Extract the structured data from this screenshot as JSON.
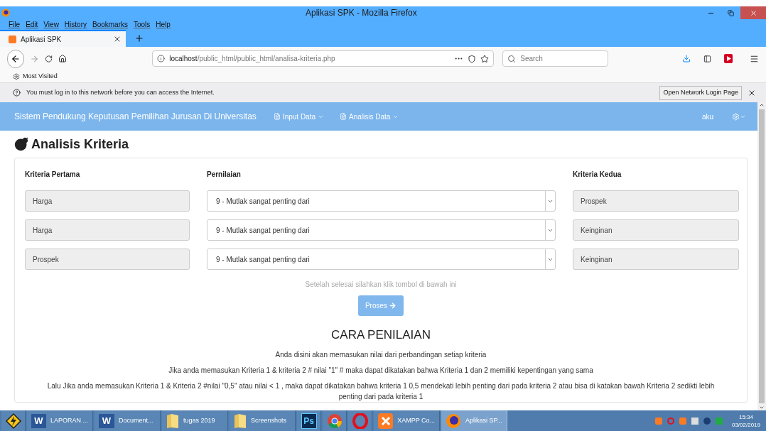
{
  "window": {
    "title": "Aplikasi SPK - Mozilla Firefox"
  },
  "menu": [
    "File",
    "Edit",
    "View",
    "History",
    "Bookmarks",
    "Tools",
    "Help"
  ],
  "tab": {
    "title": "Aplikasi SPK"
  },
  "address": {
    "host": "localhost",
    "path": "/public_html/public_html/analisa-kriteria.php"
  },
  "search": {
    "placeholder": "Search"
  },
  "bookmarks": [
    "Most Visited"
  ],
  "notification": {
    "text": "You must log in to this network before you can access the Internet.",
    "button": "Open Network Login Page"
  },
  "navbar": {
    "brand": "Sistem Pendukung Keputusan Pemilihan Jurusan Di Universitas",
    "items": [
      "Input Data",
      "Analisis Data"
    ],
    "user": "aku"
  },
  "page": {
    "heading": "Analisis Kriteria",
    "columns": [
      "Kriteria Pertama",
      "Pernilaian",
      "Kriteria Kedua"
    ],
    "rows": [
      {
        "first": "Harga",
        "rating": "9 - Mutlak sangat penting dari",
        "second": "Prospek"
      },
      {
        "first": "Harga",
        "rating": "9 - Mutlak sangat penting dari",
        "second": "Keinginan"
      },
      {
        "first": "Prospek",
        "rating": "9 - Mutlak sangat penting dari",
        "second": "Keinginan"
      }
    ],
    "hint": "Setelah selesai silahkan klik tombol di bawah ini",
    "button": "Proses",
    "section_title": "CARA PENILAIAN",
    "paragraphs": [
      "Anda disini akan memasukan nilai dari perbandingan setiap kriteria",
      "Jika anda memasukan Kriteria 1 & kriteria 2 # nilai \"1\" # maka dapat dikatakan bahwa Kriteria 1 dan 2 memiliki kepentingan yang sama",
      "Lalu Jika anda memasukan Kriteria 1 & Kriteria 2 #nilai \"0,5\" atau nilai < 1 , maka dapat dikatakan bahwa kriteria 1 0,5 mendekati lebih penting dari pada kriteria 2 atau bisa di katakan bawah Kriteria 2 sedikti lebih penting dari pada kriteria 1"
    ]
  },
  "taskbar": {
    "items": [
      {
        "kind": "winamp",
        "selected": false
      },
      {
        "kind": "word",
        "badge": "W",
        "label": "LAPORAN ...",
        "selected": false
      },
      {
        "kind": "word",
        "badge": "W",
        "label": "Document...",
        "selected": false
      },
      {
        "kind": "folder",
        "label": "tugas 2019",
        "selected": false
      },
      {
        "kind": "folder",
        "label": "Screenshots",
        "selected": false
      },
      {
        "kind": "photoshop",
        "badge": "Ps",
        "selected": false
      },
      {
        "kind": "chrome",
        "selected": false
      },
      {
        "kind": "opera",
        "selected": false
      },
      {
        "kind": "xampp",
        "label": "XAMPP Co...",
        "selected": false
      },
      {
        "kind": "firefox",
        "label": "Aplikasi SP...",
        "selected": true
      }
    ],
    "time": "15:34",
    "date": "03/02/2019"
  }
}
